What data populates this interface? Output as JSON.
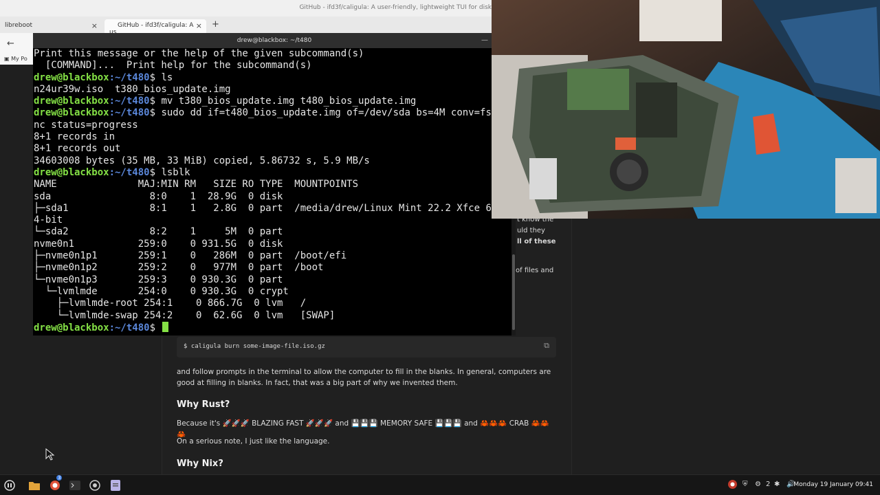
{
  "browser": {
    "window_title": "GitHub - ifd3f/caligula: A user-friendly, lightweight TUI for disk",
    "tabs": [
      {
        "label": "libreboot"
      },
      {
        "label": "GitHub - ifd3f/caligula: A us"
      }
    ],
    "bookmark": "My Po"
  },
  "terminal": {
    "title": "drew@blackbox: ~/t480",
    "prompt_user": "drew@blackbox",
    "prompt_path": ":~/t480",
    "lines": [
      {
        "type": "out",
        "text": "Print this message or the help of the given subcommand(s)"
      },
      {
        "type": "out",
        "text": "  [COMMAND]...  Print help for the subcommand(s)"
      },
      {
        "type": "cmd",
        "text": "$ ls"
      },
      {
        "type": "out",
        "text": "n24ur39w.iso  t380_bios_update.img"
      },
      {
        "type": "cmd",
        "text": "$ mv t380_bios_update.img t480_bios_update.img"
      },
      {
        "type": "cmd",
        "text": "$ sudo dd if=t480_bios_update.img of=/dev/sda bs=4M conv=fsy"
      },
      {
        "type": "out",
        "text": "nc status=progress"
      },
      {
        "type": "out",
        "text": "8+1 records in"
      },
      {
        "type": "out",
        "text": "8+1 records out"
      },
      {
        "type": "out",
        "text": "34603008 bytes (35 MB, 33 MiB) copied, 5.86732 s, 5.9 MB/s"
      },
      {
        "type": "cmd",
        "text": "$ lsblk"
      },
      {
        "type": "out",
        "text": "NAME              MAJ:MIN RM   SIZE RO TYPE  MOUNTPOINTS"
      },
      {
        "type": "out",
        "text": "sda                 8:0    1  28.9G  0 disk"
      },
      {
        "type": "out",
        "text": "├─sda1              8:1    1   2.8G  0 part  /media/drew/Linux Mint 22.2 Xfce 6"
      },
      {
        "type": "out",
        "text": "4-bit"
      },
      {
        "type": "out",
        "text": "└─sda2              8:2    1     5M  0 part"
      },
      {
        "type": "out",
        "text": "nvme0n1           259:0    0 931.5G  0 disk"
      },
      {
        "type": "out",
        "text": "├─nvme0n1p1       259:1    0   286M  0 part  /boot/efi"
      },
      {
        "type": "out",
        "text": "├─nvme0n1p2       259:2    0   977M  0 part  /boot"
      },
      {
        "type": "out",
        "text": "└─nvme0n1p3       259:3    0 930.3G  0 part"
      },
      {
        "type": "out",
        "text": "  └─lvmlmde       254:0    0 930.3G  0 crypt"
      },
      {
        "type": "out",
        "text": "    ├─lvmlmde-root 254:1    0 866.7G  0 lvm   /"
      },
      {
        "type": "out",
        "text": "    └─lvmlmde-swap 254:2    0  62.6G  0 lvm   [SWAP]"
      },
      {
        "type": "prompt",
        "text": "$ "
      }
    ]
  },
  "page": {
    "frag1": "t know the",
    "frag2": "uld they",
    "frag3": "ll of these",
    "frag4": "of files and",
    "code": "$ caligula burn some-image-file.iso.gz",
    "p1": "and follow prompts in the terminal to allow the computer to fill in the blanks. In general, computers are good at filling in blanks. In fact, that was a big part of why we invented them.",
    "h_rust": "Why Rust?",
    "p_rust": "Because it's 🚀🚀🚀 BLAZING FAST 🚀🚀🚀 and 💾💾💾 MEMORY SAFE 💾💾💾 and 🦀🦀🦀 CRAB 🦀🦀🦀",
    "p_serious": "On a serious note, I just like the language.",
    "h_nix": "Why Nix?"
  },
  "taskbar": {
    "badge": "3",
    "wifi_count": "2",
    "clock": "Monday 19 January 09:41"
  }
}
